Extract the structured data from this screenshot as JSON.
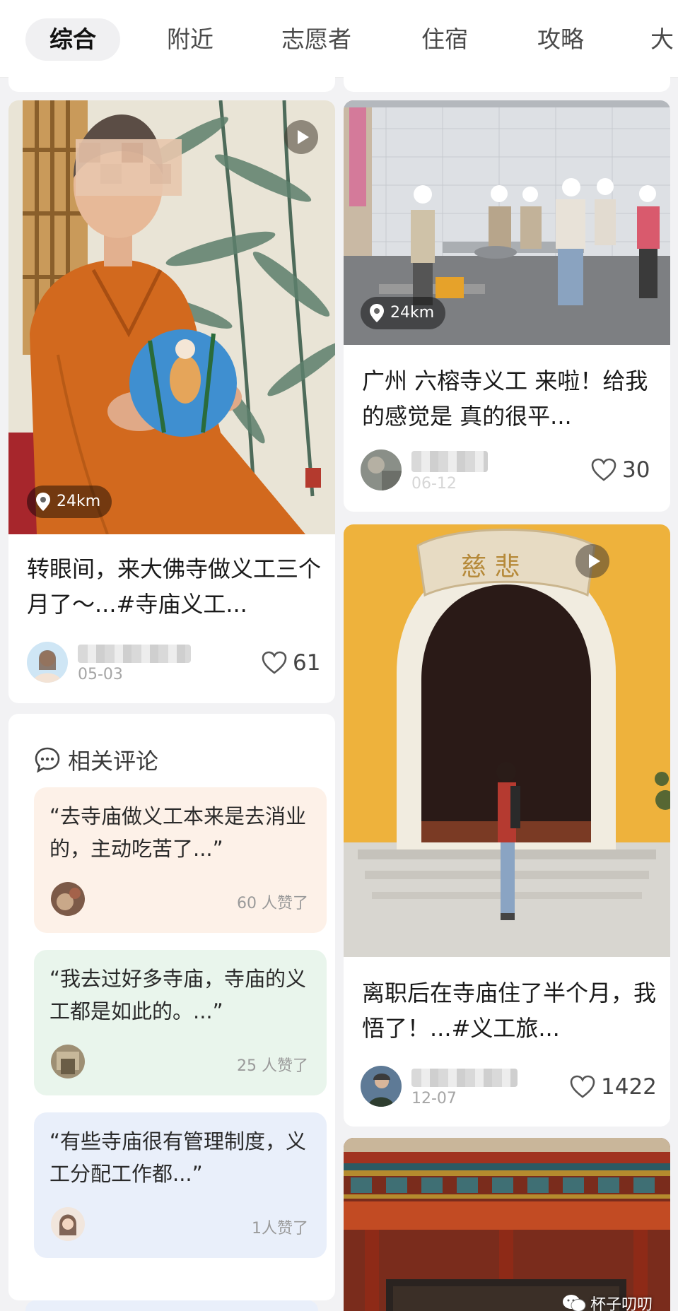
{
  "tabs": [
    "综合",
    "附近",
    "志愿者",
    "住宿",
    "攻略",
    "大"
  ],
  "cards": [
    {
      "title": "转眼间，来大佛寺做义工三个月了～...#寺庙义工...",
      "distance": "24km",
      "date": "05-03",
      "likes": "61"
    },
    {
      "title": "广州 六榕寺义工 来啦！给我的感觉是 真的很平...",
      "distance": "24km",
      "date": "06-12",
      "likes": "30"
    },
    {
      "title": "离职后在寺庙住了半个月，我悟了！...#义工旅...",
      "date": "12-07",
      "likes": "1422",
      "gate_plaque": "慈 悲"
    }
  ],
  "related_comments": {
    "header": "相关评论",
    "items": [
      {
        "text": "“去寺庙做义工本来是去消业的，主动吃苦了...”",
        "likes": "60 人赞了",
        "bg": "#fdf1e8"
      },
      {
        "text": "“我去过好多寺庙，寺庙的义工都是如此的。...”",
        "likes": "25 人赞了",
        "bg": "#e9f5ec"
      },
      {
        "text": "“有些寺庙很有管理制度，义工分配工作都...”",
        "likes": "1人赞了",
        "bg": "#e9effa"
      }
    ]
  },
  "watermark": "杯子叨叨",
  "colors": {
    "robe": "#d2691e",
    "wall_yellow": "#eeb23c",
    "heart_outline": "#555555"
  }
}
